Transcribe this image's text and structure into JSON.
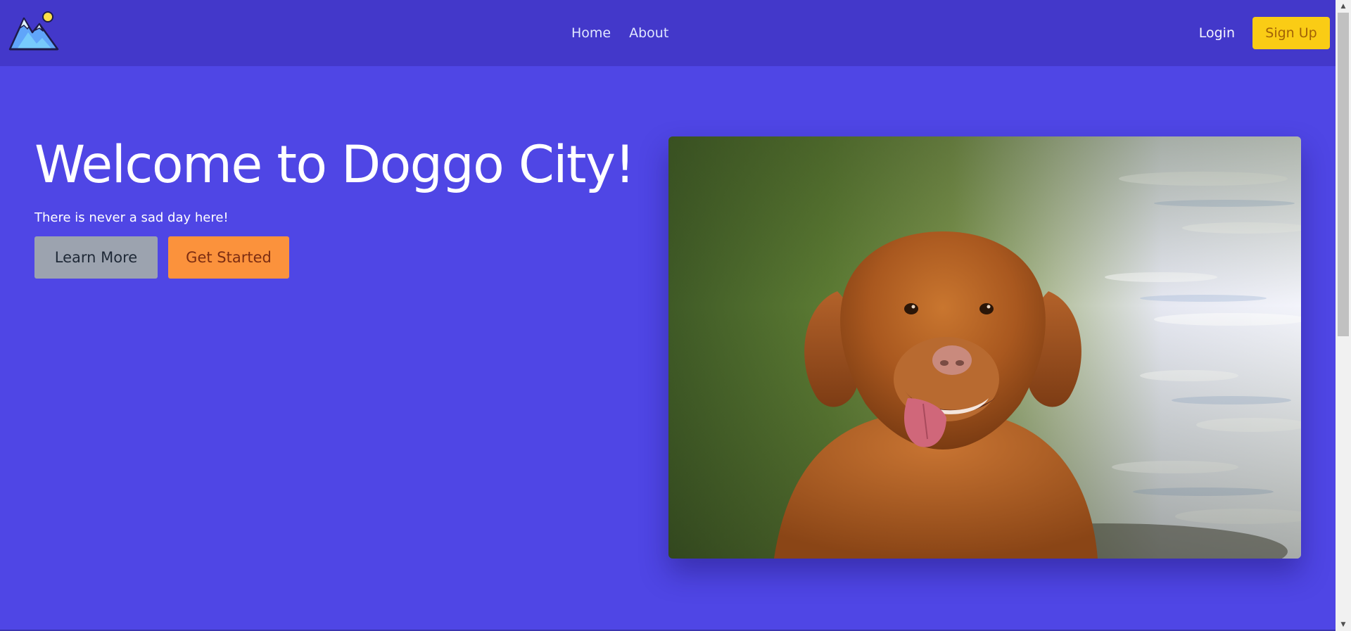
{
  "header": {
    "logo_icon": "mountain-sun-logo-icon",
    "nav": [
      {
        "label": "Home"
      },
      {
        "label": "About"
      }
    ],
    "login_label": "Login",
    "signup_label": "Sign Up"
  },
  "hero": {
    "title": "Welcome to Doggo City!",
    "subtitle": "There is never a sad day here!",
    "learn_more_label": "Learn More",
    "get_started_label": "Get Started",
    "image_subject": "golden-retriever-photo"
  },
  "colors": {
    "page_background": "#4f46e5",
    "navbar_background": "#4338ca",
    "signup_button": "#facc15",
    "learn_more_button": "#9ca3af",
    "get_started_button": "#fb923c"
  },
  "scrollbar": {
    "up_icon": "triangle-up-icon",
    "down_icon": "triangle-down-icon"
  }
}
